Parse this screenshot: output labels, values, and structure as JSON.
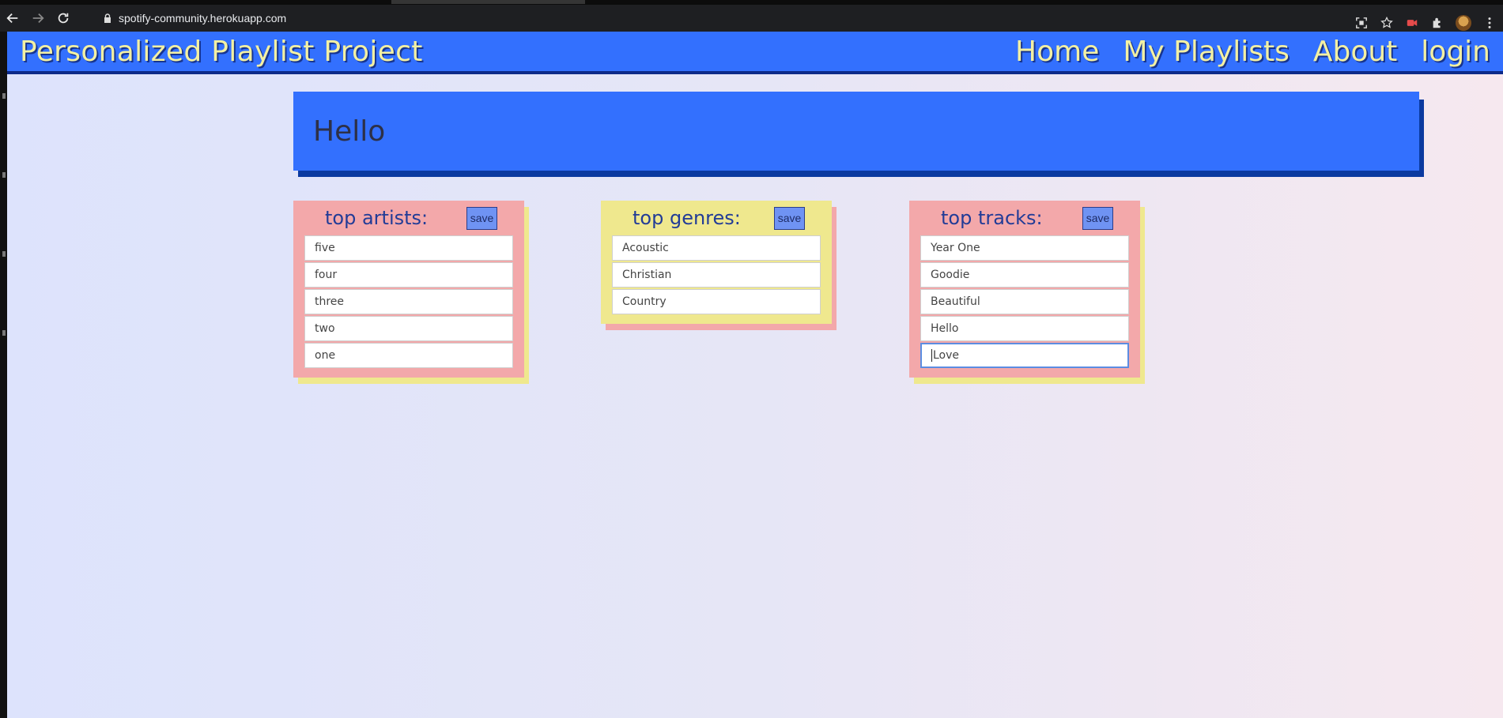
{
  "browser": {
    "url": "spotify-community.herokuapp.com"
  },
  "nav": {
    "brand": "Personalized Playlist Project",
    "links": [
      "Home",
      "My Playlists",
      "About",
      "login"
    ]
  },
  "hero": {
    "title": "Hello"
  },
  "cards": {
    "artists": {
      "title": "top artists:",
      "save_label": "save",
      "items": [
        "five",
        "four",
        "three",
        "two",
        "one"
      ]
    },
    "genres": {
      "title": "top genres:",
      "save_label": "save",
      "items": [
        "Acoustic",
        "Christian",
        "Country"
      ]
    },
    "tracks": {
      "title": "top tracks:",
      "save_label": "save",
      "items": [
        "Year One",
        "Goodie",
        "Beautiful",
        "Hello",
        "Love"
      ]
    }
  },
  "colors": {
    "nav_blue": "#3370fe",
    "brand_yellow": "#f3f0a3",
    "card_pink": "#f3a8aa",
    "card_yellow": "#efe88e"
  }
}
